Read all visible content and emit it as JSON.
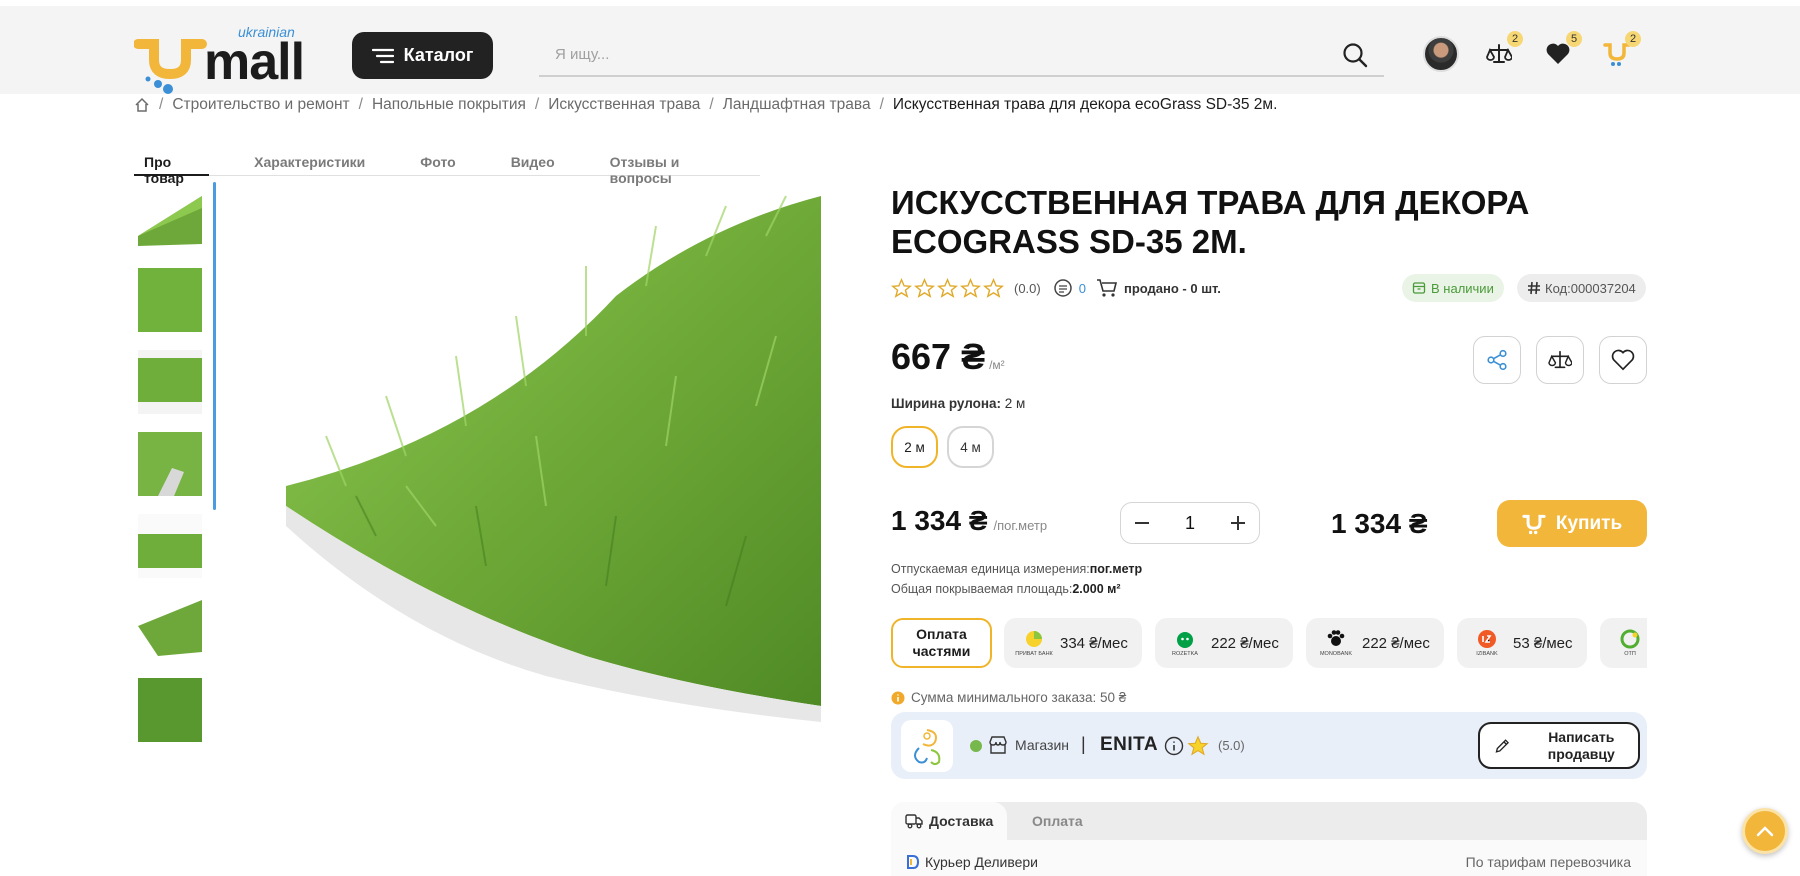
{
  "header": {
    "logo": {
      "small": "ukrainian",
      "main": "mall"
    },
    "catalog_label": "Каталог",
    "search_placeholder": "Я ищу...",
    "compare_count": "2",
    "favorites_count": "5",
    "cart_count": "2"
  },
  "breadcrumb": {
    "items": [
      "Строительство и ремонт",
      "Напольные покрытия",
      "Искусственная трава",
      "Ландшафтная трава"
    ],
    "current": "Искусственная трава для декора ecoGrass SD-35 2м."
  },
  "product_tabs": [
    "Про товар",
    "Характеристики",
    "Фото",
    "Видео",
    "Отзывы и вопросы"
  ],
  "product": {
    "title": "Искусственная трава для декора ecoGrass SD-35 2м.",
    "rating": "(0.0)",
    "reviews_count": "0",
    "sold": "продано - 0 шт.",
    "stock": "В наличии",
    "code": "Код:000037204",
    "price": "667 ₴",
    "price_unit": "/м²",
    "width_label": "Ширина рулона:",
    "width_value": "2 м",
    "width_options": [
      "2 м",
      "4 м"
    ],
    "unit_price": "1 334 ₴",
    "unit_price_unit": "/пог.метр",
    "quantity": "1",
    "total": "1 334 ₴",
    "buy_label": "Купить",
    "unit_info_label": "Отпускаемая единица измерения:",
    "unit_info_value": "пог.метр",
    "area_label": "Общая покрываемая площадь:",
    "area_value": "2.000 м²"
  },
  "payment": {
    "installments_label": "Оплата частями",
    "options": [
      {
        "bank": "ПРИВАТ БАНК",
        "amount": "334 ₴/мес",
        "color": "#8cc63f"
      },
      {
        "bank": "ROZETKA",
        "amount": "222 ₴/мес",
        "color": "#00a046"
      },
      {
        "bank": "MONOBANK",
        "amount": "222 ₴/мес",
        "color": "#111111"
      },
      {
        "bank": "IZIBANK",
        "amount": "53 ₴/мес",
        "color": "#f15a24"
      },
      {
        "bank": "ОТП",
        "amount": "",
        "color": "#52ae30"
      }
    ]
  },
  "min_order": "Сумма минимального заказа: 50 ₴",
  "seller": {
    "type": "Магазин",
    "separator": "|",
    "name": "ENITA",
    "rating": "(5.0)",
    "write_label": "Написать продавцу"
  },
  "delivery_tabs": {
    "delivery": "Доставка",
    "payment": "Оплата"
  },
  "delivery_row": {
    "name": "Курьер Деливери",
    "price": "По тарифам перевозчика"
  },
  "colors": {
    "accent": "#f2b63a",
    "active_border": "#f0b429",
    "link": "#3a8fd6",
    "stock_green": "#4a9a3a"
  },
  "icons": [
    "search-icon",
    "compare-icon",
    "heart-icon",
    "cart-icon",
    "home-icon",
    "share-icon",
    "info-icon",
    "shop-icon",
    "pencil-icon",
    "truck-icon",
    "chevron-up-icon"
  ]
}
